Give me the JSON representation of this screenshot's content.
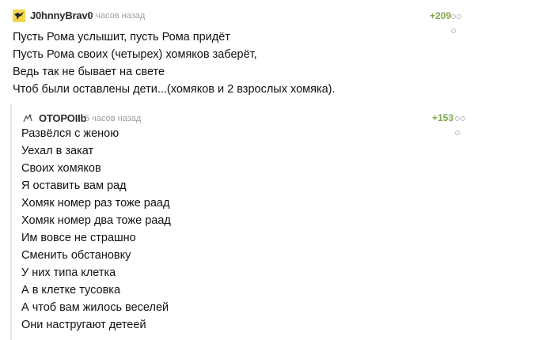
{
  "comment": {
    "author": "J0hnnyBrav0",
    "timestamp": "6 часов назад",
    "rating": "+209",
    "avatar_icon": "bird-avatar-icon",
    "more_icon": "more-dots-icon",
    "lines": [
      "Пусть Рома услышит, пусть Рома придёт",
      "Пусть Рома своих (четырех) хомяков заберёт,",
      "Ведь так не бывает на свете",
      "Чтоб были оставлены дети...(хомяков и 2 взрослых хомяка)."
    ]
  },
  "reply": {
    "author": "OTOPOIIb",
    "timestamp": "5 часов назад",
    "rating": "+153",
    "avatar_icon": "small-avatar-icon",
    "more_icon": "more-dots-icon",
    "lines": [
      "Развёлся с женою",
      "Уехал в закат",
      "Своих хомяков",
      "Я оставить вам рад",
      "Хомяк номер раз тоже раад",
      "Хомяк номер два тоже раад",
      "Им вовсе не страшно",
      "Сменить обстановку",
      "У них типа клетка",
      "А в клетке тусовка",
      "А чтоб вам жилось веселей",
      "Они настругают детеей"
    ]
  },
  "colors": {
    "rating": "#7ea84b",
    "meta": "#9aa0a6",
    "thread_line": "#e4e7ea"
  }
}
